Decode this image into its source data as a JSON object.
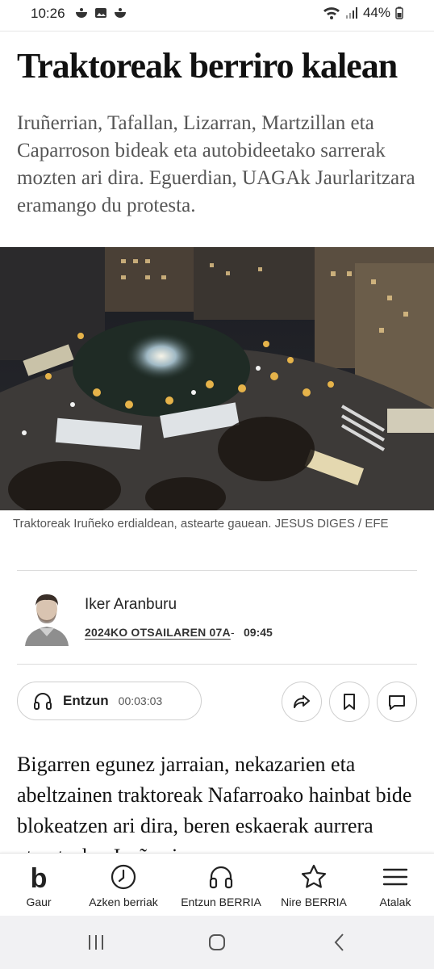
{
  "status_bar": {
    "time": "10:26",
    "battery": "44%"
  },
  "article": {
    "headline": "Traktoreak berriro kalean",
    "lead": "Iruñerrian, Tafallan, Lizarran, Martzillan eta Caparroson bideak eta autobideetako sarrerak mozten ari dira. Eguerdian, UAGAk Jaurlaritzara eramango du protesta.",
    "caption": "Traktoreak Iruñeko erdialdean, astearte gauean. JESUS DIGES / EFE",
    "author": "Iker Aranburu",
    "date": "2024KO OTSAILAREN 07A",
    "date_separator": "-",
    "time": "09:45",
    "body": "Bigarren egunez jarraian, nekazarien eta abeltzainen traktoreak Nafarroako hainbat bide blokeatzen ari dira, beren eskaerak aurrera ateratzeko. Iruñerrian"
  },
  "audio": {
    "label": "Entzun",
    "duration": "00:03:03"
  },
  "bottom_nav": {
    "items": [
      {
        "label": "Gaur",
        "icon": "b-logo-icon"
      },
      {
        "label": "Azken berriak",
        "icon": "clock-icon"
      },
      {
        "label": "Entzun BERRIA",
        "icon": "headphones-icon"
      },
      {
        "label": "Nire BERRIA",
        "icon": "star-icon"
      },
      {
        "label": "Atalak",
        "icon": "menu-icon"
      }
    ]
  },
  "colors": {
    "text": "#111111",
    "lead": "#555555",
    "border": "#cfcfcf",
    "system_nav": "#f1f1f3"
  }
}
